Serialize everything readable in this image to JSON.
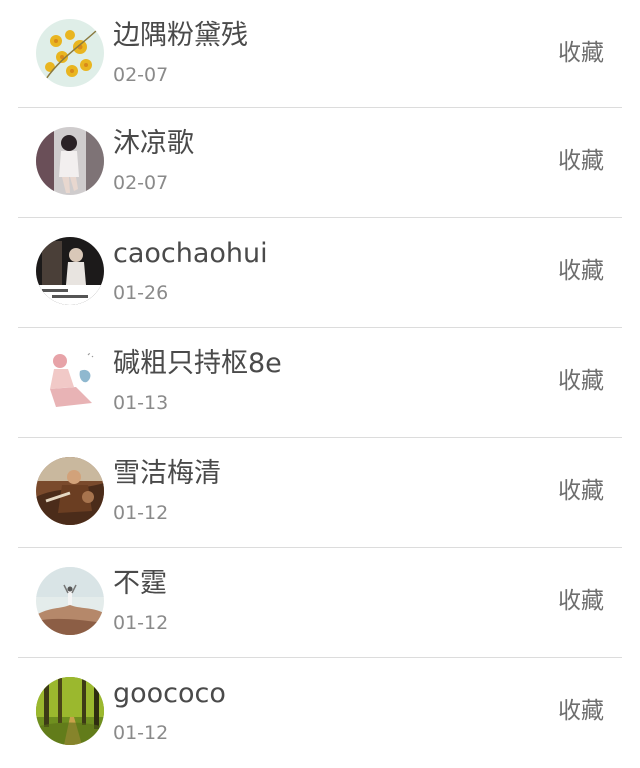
{
  "favorites_list": {
    "action_label": "收藏",
    "items": [
      {
        "name": "边隅粉黛残",
        "date": "02-07",
        "avatar_icon": "yellow-flowers-avatar"
      },
      {
        "name": "沐凉歌",
        "date": "02-07",
        "avatar_icon": "portrait-photo-avatar"
      },
      {
        "name": "caochaohui",
        "date": "01-26",
        "avatar_icon": "text-poster-avatar"
      },
      {
        "name": "碱粗只持枢8e",
        "date": "01-13",
        "avatar_icon": "cartoon-girl-avatar"
      },
      {
        "name": "雪洁梅清",
        "date": "01-12",
        "avatar_icon": "warrior-artwork-avatar"
      },
      {
        "name": "不霆",
        "date": "01-12",
        "avatar_icon": "person-on-rocks-avatar"
      },
      {
        "name": "goococo",
        "date": "01-12",
        "avatar_icon": "forest-path-avatar"
      }
    ]
  }
}
